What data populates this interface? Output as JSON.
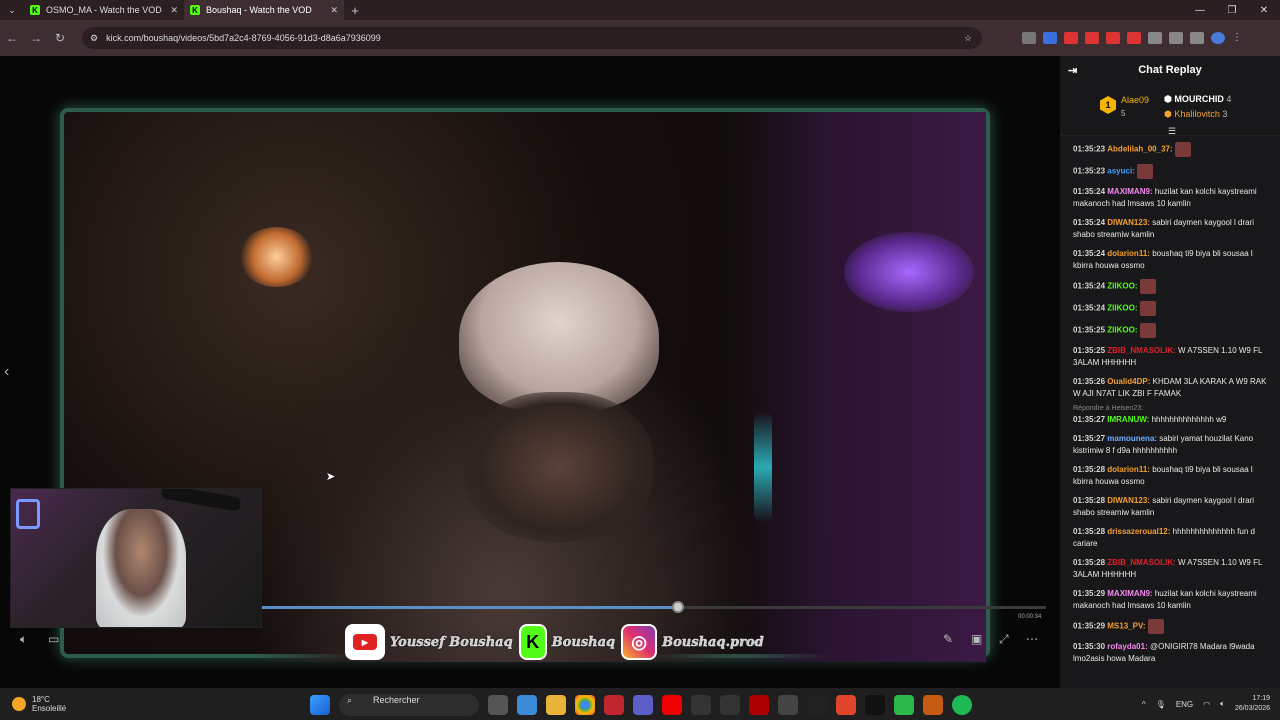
{
  "browser": {
    "tabs": [
      {
        "title": "OSMO_MA - Watch the VOD of"
      },
      {
        "title": "Boushaq - Watch the VOD"
      }
    ],
    "url": "kick.com/boushaq/videos/5bd7a2c4-8769-4056-91d3-d8a6a7936099"
  },
  "player": {
    "progress": 0.53,
    "timecode": "00:00:34",
    "socials": [
      {
        "name": "Youssef Boushaq",
        "icon": "youtube-icon"
      },
      {
        "name": "Boushaq",
        "icon": "kick-icon"
      },
      {
        "name": "Boushaq.prod",
        "icon": "instagram-icon"
      }
    ]
  },
  "chat": {
    "title": "Chat Replay",
    "leaderboard": {
      "first": {
        "rank": "1",
        "name": "Alae09",
        "count": "5"
      },
      "second": {
        "name": "MOURCHID",
        "count": "4"
      },
      "third": {
        "name": "Khalilovitch",
        "count": "3"
      }
    },
    "reply_label": "Répondre à Heisen23:",
    "messages": [
      {
        "time": "01:35:23",
        "user": "Abdelilah_00_37:",
        "color": "#f5a030",
        "text": "",
        "emote": true
      },
      {
        "time": "01:35:23",
        "user": "asyuci:",
        "color": "#4a9cff",
        "text": "",
        "emote": true
      },
      {
        "time": "01:35:24",
        "user": "MAXIMAN9:",
        "color": "#f58af0",
        "text": "huzilat kan kolchi kaystreami makanoch had lmsaws 10 kamlin"
      },
      {
        "time": "01:35:24",
        "user": "DIWAN123:",
        "color": "#f5a030",
        "text": "sabiri daymen kaygool l drari shabo streamiw kamlin"
      },
      {
        "time": "01:35:24",
        "user": "dolarion11:",
        "color": "#f5a030",
        "text": "boushaq ti9 biya bli sousaa l kbirra houwa ossmo"
      },
      {
        "time": "01:35:24",
        "user": "ZIIKOO:",
        "color": "#53fc18",
        "text": "",
        "emote": true
      },
      {
        "time": "01:35:24",
        "user": "ZIIKOO:",
        "color": "#53fc18",
        "text": "",
        "emote": true
      },
      {
        "time": "01:35:25",
        "user": "ZIIKOO:",
        "color": "#53fc18",
        "text": "",
        "emote": true
      },
      {
        "time": "01:35:25",
        "user": "ZBIB_NMASOLIK:",
        "color": "#e0222a",
        "text": "W A7SSEN 1.10 W9 FL 3ALAM HHHHHH"
      },
      {
        "time": "01:35:26",
        "user": "Oualid4DP:",
        "color": "#f5a030",
        "text": "KHDAM 3LA KARAK A W9 RAK W AJI N7AT LIK ZBI F FAMAK"
      },
      {
        "time": "01:35:27",
        "user": "IMRANUW:",
        "color": "#53fc18",
        "text": "hhhhhhhhhhhhhh w9",
        "reply": true
      },
      {
        "time": "01:35:27",
        "user": "mamounena:",
        "color": "#6ab0ff",
        "text": "sabiri yamat houzilat Kano kistrimiw 8 f d9a hhhhhhhhhh"
      },
      {
        "time": "01:35:28",
        "user": "dolarion11:",
        "color": "#f5a030",
        "text": "boushaq ti9 biya bli sousaa l kbirra houwa ossmo"
      },
      {
        "time": "01:35:28",
        "user": "DIWAN123:",
        "color": "#f5a030",
        "text": "sabiri daymen kaygool l drari shabo streamiw kamlin"
      },
      {
        "time": "01:35:28",
        "user": "drissazeroual12:",
        "color": "#f5a030",
        "text": "hhhhhhhhhhhhhh fun d cariare"
      },
      {
        "time": "01:35:28",
        "user": "ZBIB_NMASOLIK:",
        "color": "#e0222a",
        "text": "W A7SSEN 1.10 W9 FL 3ALAM HHHHHH"
      },
      {
        "time": "01:35:29",
        "user": "MAXIMAN9:",
        "color": "#f58af0",
        "text": "huzilat kan kolchi kaystreami makanoch had lmsaws 10 kamlin"
      },
      {
        "time": "01:35:29",
        "user": "MS13_PV:",
        "color": "#f5a030",
        "text": "",
        "emote": true
      },
      {
        "time": "01:35:30",
        "user": "rofayda01:",
        "color": "#f58af0",
        "text": "@ONIGIRI78 Madara l9wada lmo2asis howa Madara"
      }
    ]
  },
  "taskbar": {
    "temperature": "18°C",
    "weather": "Ensoleillé",
    "search_label": "Rechercher",
    "language": "ENG",
    "time": "17:19",
    "date": "26/03/2026"
  }
}
